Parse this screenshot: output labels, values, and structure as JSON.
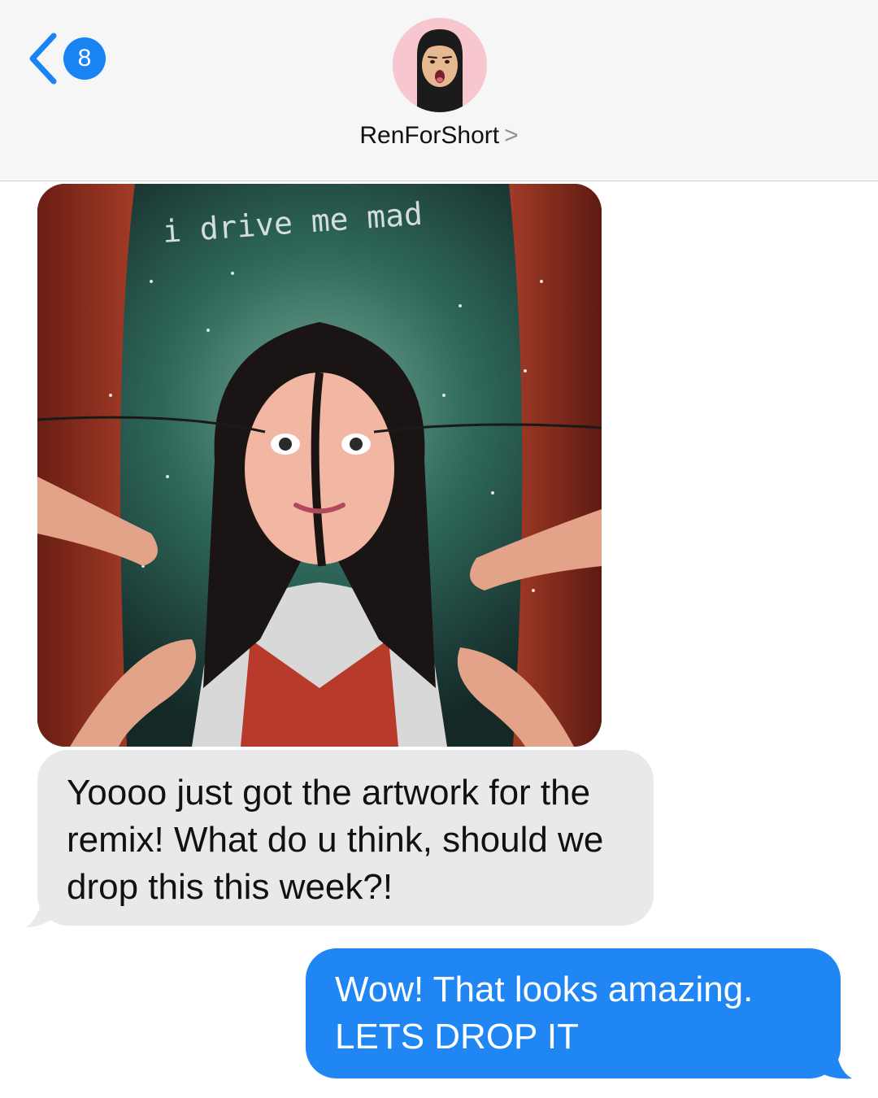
{
  "header": {
    "unread_count": "8",
    "contact_name": "RenForShort",
    "contact_chevron": ">"
  },
  "artwork": {
    "lettering": "i drive me mad"
  },
  "messages": {
    "incoming": "Yoooo just got the artwork for the remix! What do u think, should we drop this this week?!",
    "outgoing": "Wow! That looks amazing. LETS DROP IT"
  },
  "colors": {
    "accent": "#1a84f5",
    "incoming_bubble": "#e9e9eb",
    "outgoing_bubble": "#1f86f4",
    "header_bg": "#f6f6f7"
  },
  "icons": {
    "back": "chevron-left-icon",
    "forward": "chevron-right-icon"
  }
}
